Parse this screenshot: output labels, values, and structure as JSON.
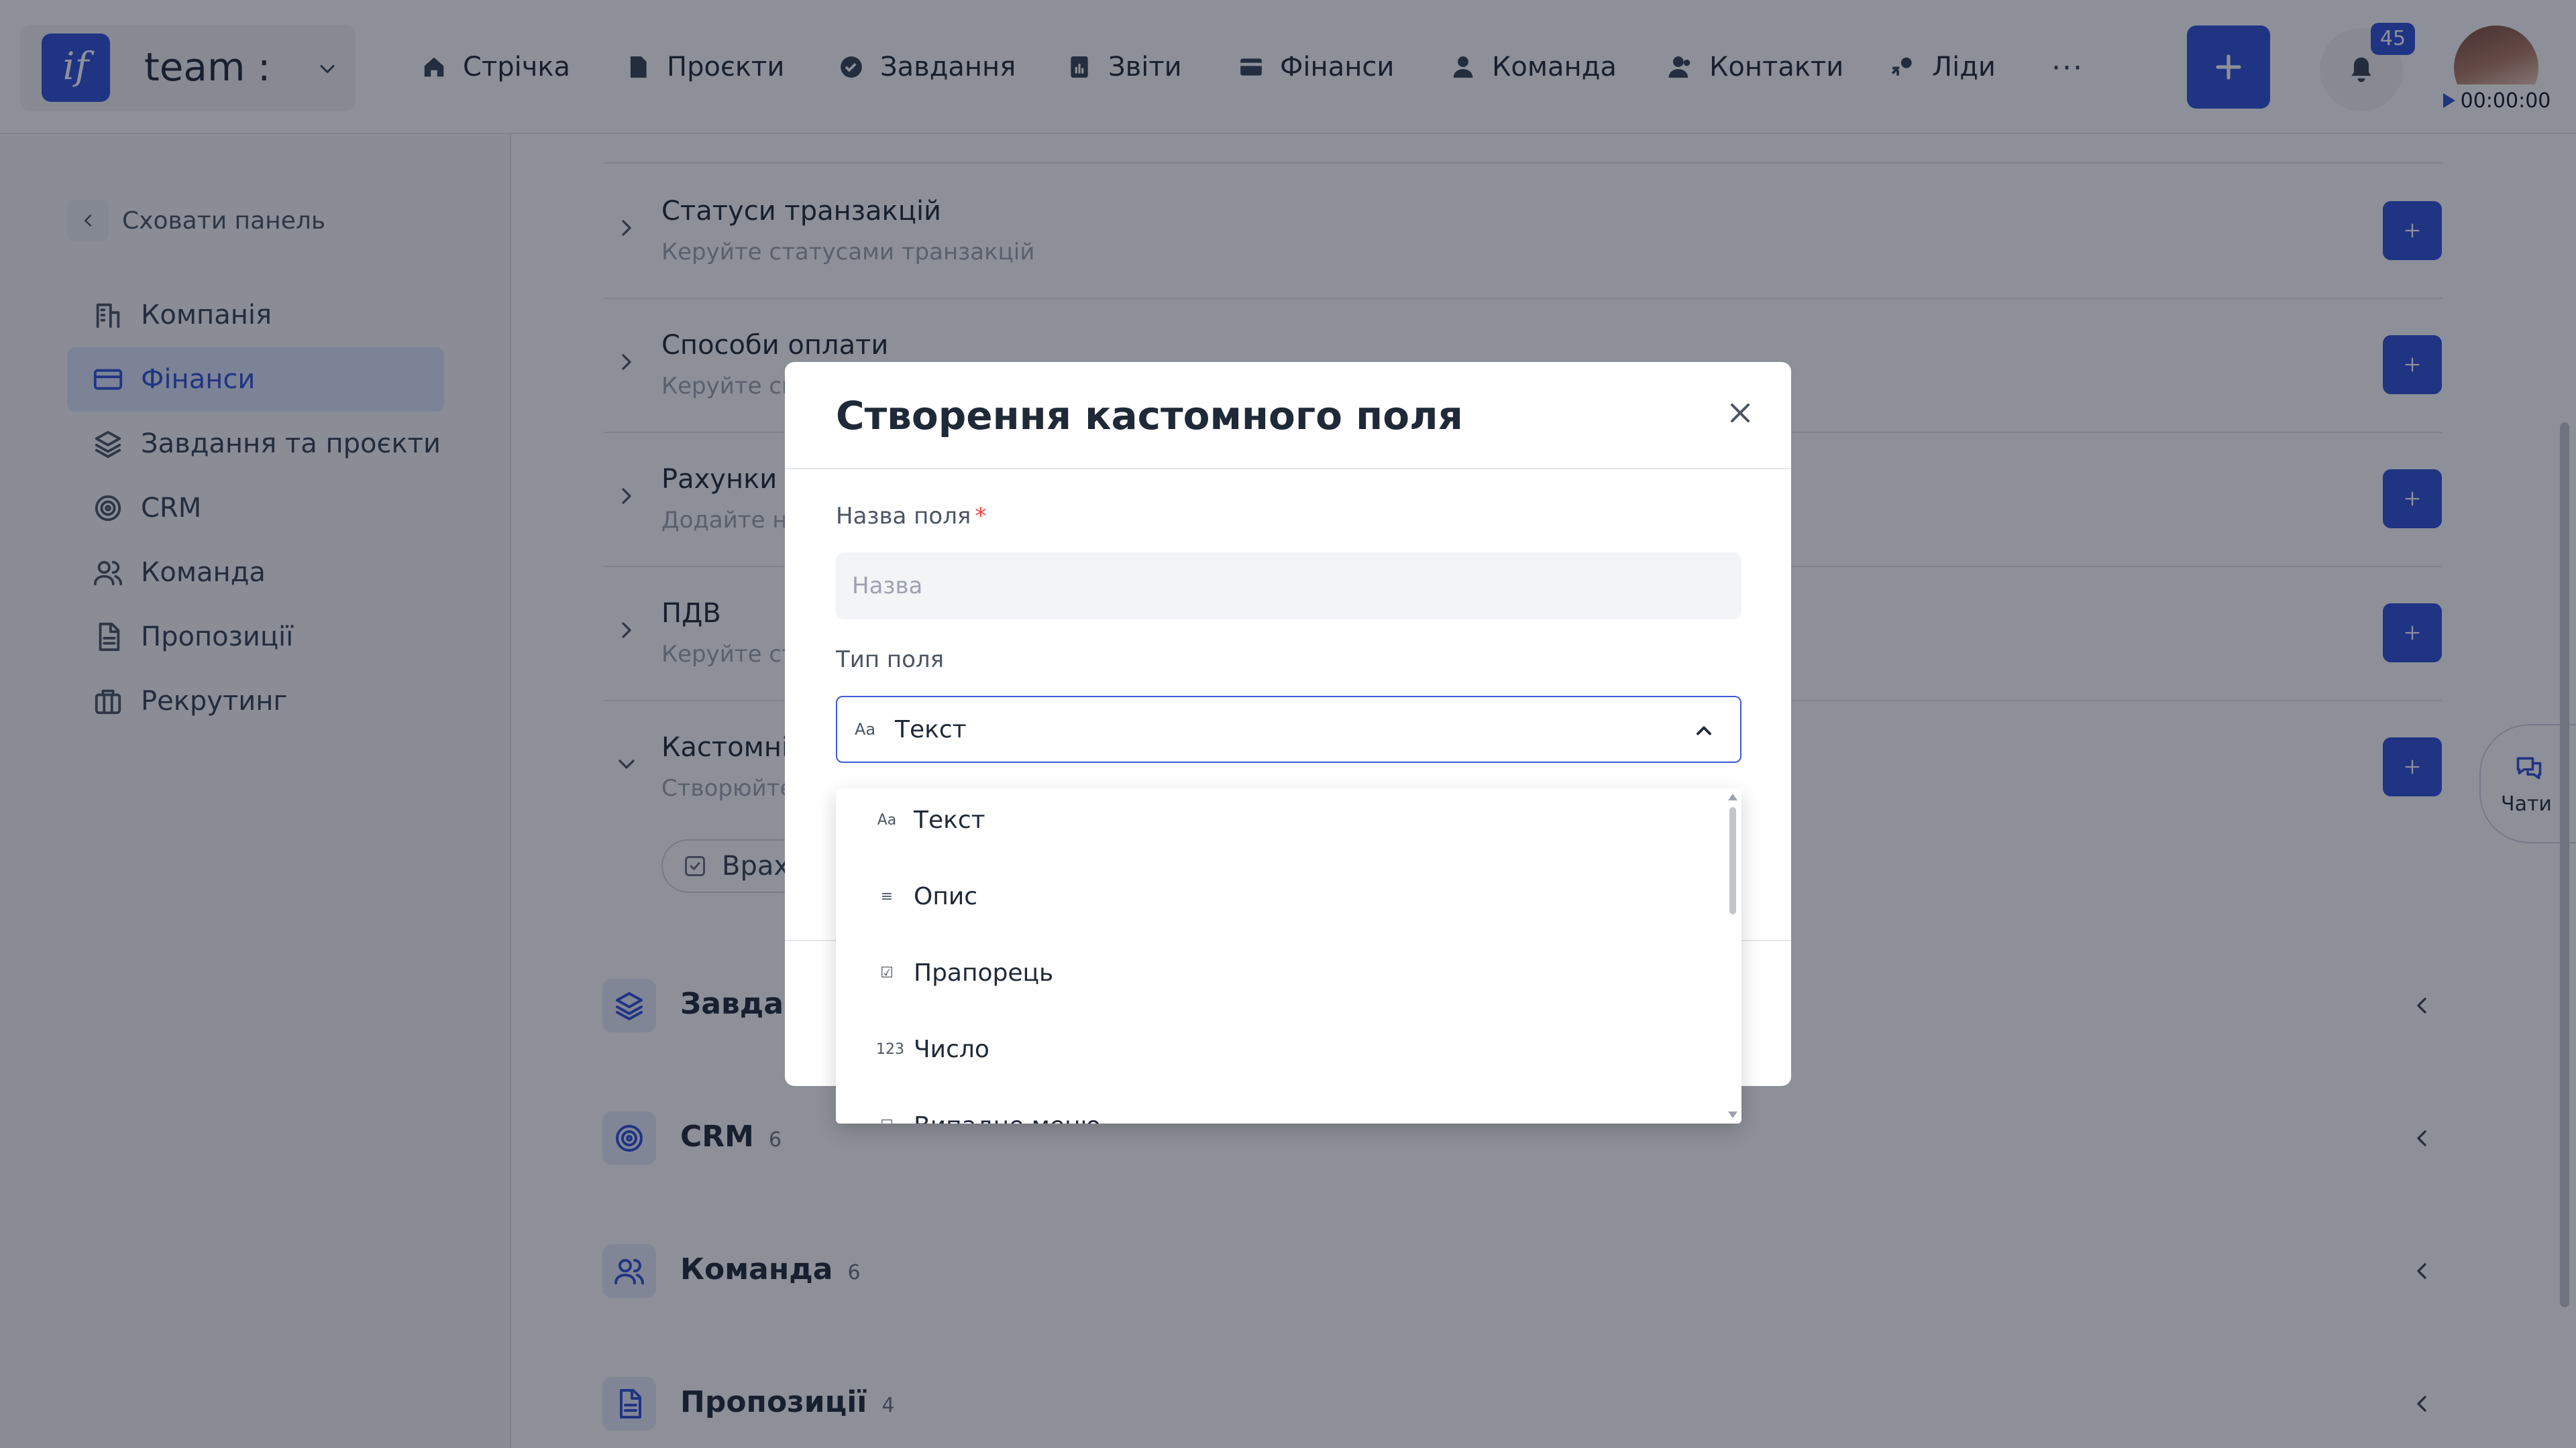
{
  "header": {
    "brand": "team :",
    "logo_mark": "if",
    "nav": [
      {
        "label": "Стрічка",
        "icon": "home-icon"
      },
      {
        "label": "Проєкти",
        "icon": "document-icon"
      },
      {
        "label": "Завдання",
        "icon": "check-circle-icon"
      },
      {
        "label": "Звіти",
        "icon": "report-icon"
      },
      {
        "label": "Фінанси",
        "icon": "wallet-icon"
      },
      {
        "label": "Команда",
        "icon": "user-icon"
      },
      {
        "label": "Контакти",
        "icon": "contacts-icon"
      },
      {
        "label": "Ліди",
        "icon": "leads-icon"
      }
    ],
    "more": "···",
    "notifications_count": "45",
    "timer": "00:00:00"
  },
  "sidebar": {
    "hide_label": "Сховати панель",
    "items": [
      {
        "label": "Компанія",
        "icon": "company-icon"
      },
      {
        "label": "Фінанси",
        "icon": "card-icon",
        "active": true
      },
      {
        "label": "Завдання та проєкти",
        "icon": "layers-icon"
      },
      {
        "label": "CRM",
        "icon": "target-icon"
      },
      {
        "label": "Команда",
        "icon": "users-icon"
      },
      {
        "label": "Пропозиції",
        "icon": "file-text-icon"
      },
      {
        "label": "Рекрутинг",
        "icon": "briefcase-icon"
      }
    ]
  },
  "finance_settings": {
    "rows": [
      {
        "title": "Статуси транзакцій",
        "subtitle": "Керуйте статусами транзакцій",
        "expanded": false
      },
      {
        "title": "Способи оплати",
        "subtitle": "Керуйте сп",
        "expanded": false
      },
      {
        "title": "Рахунки к",
        "subtitle": "Додайте но",
        "expanded": false
      },
      {
        "title": "ПДВ",
        "subtitle": "Керуйте ст",
        "expanded": false
      },
      {
        "title": "Кастомні",
        "subtitle": "Створюйте",
        "expanded": true
      }
    ],
    "consider_button": "Врах"
  },
  "sections": [
    {
      "title": "Завдан",
      "count": "",
      "icon": "layers-icon"
    },
    {
      "title": "CRM",
      "count": "6",
      "icon": "target-icon"
    },
    {
      "title": "Команда",
      "count": "6",
      "icon": "users-icon"
    },
    {
      "title": "Пропозиції",
      "count": "4",
      "icon": "file-text-icon"
    }
  ],
  "chats_label": "Чати",
  "modal": {
    "title": "Створення кастомного поля",
    "name_label": "Назва поля",
    "required_mark": "*",
    "name_placeholder": "Назва",
    "name_value": "",
    "type_label": "Тип поля",
    "type_selected": "Текст",
    "type_selected_icon": "Aa"
  },
  "dropdown": {
    "options": [
      {
        "label": "Текст",
        "icon": "Aa"
      },
      {
        "label": "Опис",
        "icon": "≡"
      },
      {
        "label": "Прапорець",
        "icon": "☑"
      },
      {
        "label": "Число",
        "icon": "123"
      },
      {
        "label": "Випадне меню",
        "icon": "☐"
      }
    ]
  },
  "colors": {
    "accent": "#2f4fd8",
    "overlay": "rgba(17,24,39,0.48)",
    "required": "#ef4444"
  }
}
